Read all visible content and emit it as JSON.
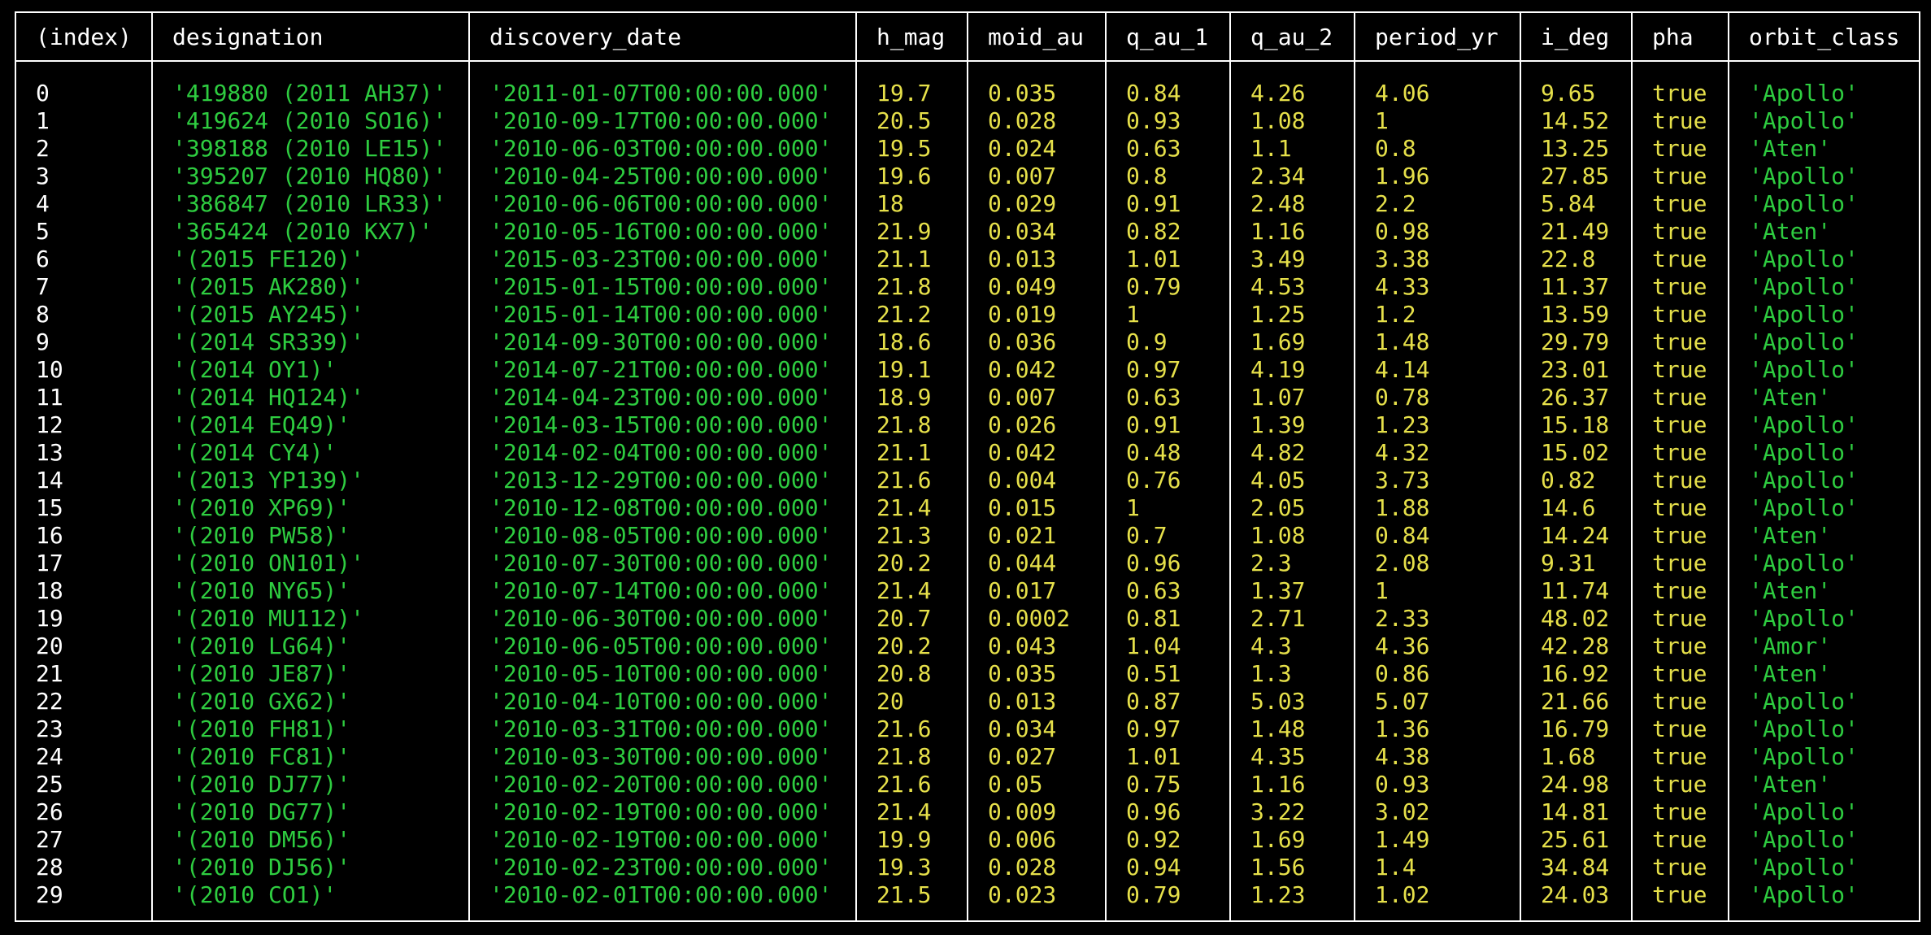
{
  "colors": {
    "background": "#000000",
    "border": "#ffffff",
    "index_text": "#ffffff",
    "string_text": "#2ecc40",
    "number_text": "#e6e04a"
  },
  "columns": [
    {
      "key": "index",
      "label": "(index)",
      "color": "white"
    },
    {
      "key": "designation",
      "label": "designation",
      "color": "green"
    },
    {
      "key": "discovery_date",
      "label": "discovery_date",
      "color": "green"
    },
    {
      "key": "h_mag",
      "label": "h_mag",
      "color": "yellow"
    },
    {
      "key": "moid_au",
      "label": "moid_au",
      "color": "yellow"
    },
    {
      "key": "q_au_1",
      "label": "q_au_1",
      "color": "yellow"
    },
    {
      "key": "q_au_2",
      "label": "q_au_2",
      "color": "yellow"
    },
    {
      "key": "period_yr",
      "label": "period_yr",
      "color": "yellow"
    },
    {
      "key": "i_deg",
      "label": "i_deg",
      "color": "yellow"
    },
    {
      "key": "pha",
      "label": "pha",
      "color": "yellow"
    },
    {
      "key": "orbit_class",
      "label": "orbit_class",
      "color": "green"
    }
  ],
  "rows": [
    [
      "0",
      "'419880 (2011 AH37)'",
      "'2011-01-07T00:00:00.000'",
      "19.7",
      "0.035",
      "0.84",
      "4.26",
      "4.06",
      "9.65",
      "true",
      "'Apollo'"
    ],
    [
      "1",
      "'419624 (2010 SO16)'",
      "'2010-09-17T00:00:00.000'",
      "20.5",
      "0.028",
      "0.93",
      "1.08",
      "1",
      "14.52",
      "true",
      "'Apollo'"
    ],
    [
      "2",
      "'398188 (2010 LE15)'",
      "'2010-06-03T00:00:00.000'",
      "19.5",
      "0.024",
      "0.63",
      "1.1",
      "0.8",
      "13.25",
      "true",
      "'Aten'"
    ],
    [
      "3",
      "'395207 (2010 HQ80)'",
      "'2010-04-25T00:00:00.000'",
      "19.6",
      "0.007",
      "0.8",
      "2.34",
      "1.96",
      "27.85",
      "true",
      "'Apollo'"
    ],
    [
      "4",
      "'386847 (2010 LR33)'",
      "'2010-06-06T00:00:00.000'",
      "18",
      "0.029",
      "0.91",
      "2.48",
      "2.2",
      "5.84",
      "true",
      "'Apollo'"
    ],
    [
      "5",
      "'365424 (2010 KX7)'",
      "'2010-05-16T00:00:00.000'",
      "21.9",
      "0.034",
      "0.82",
      "1.16",
      "0.98",
      "21.49",
      "true",
      "'Aten'"
    ],
    [
      "6",
      "'(2015 FE120)'",
      "'2015-03-23T00:00:00.000'",
      "21.1",
      "0.013",
      "1.01",
      "3.49",
      "3.38",
      "22.8",
      "true",
      "'Apollo'"
    ],
    [
      "7",
      "'(2015 AK280)'",
      "'2015-01-15T00:00:00.000'",
      "21.8",
      "0.049",
      "0.79",
      "4.53",
      "4.33",
      "11.37",
      "true",
      "'Apollo'"
    ],
    [
      "8",
      "'(2015 AY245)'",
      "'2015-01-14T00:00:00.000'",
      "21.2",
      "0.019",
      "1",
      "1.25",
      "1.2",
      "13.59",
      "true",
      "'Apollo'"
    ],
    [
      "9",
      "'(2014 SR339)'",
      "'2014-09-30T00:00:00.000'",
      "18.6",
      "0.036",
      "0.9",
      "1.69",
      "1.48",
      "29.79",
      "true",
      "'Apollo'"
    ],
    [
      "10",
      "'(2014 OY1)'",
      "'2014-07-21T00:00:00.000'",
      "19.1",
      "0.042",
      "0.97",
      "4.19",
      "4.14",
      "23.01",
      "true",
      "'Apollo'"
    ],
    [
      "11",
      "'(2014 HQ124)'",
      "'2014-04-23T00:00:00.000'",
      "18.9",
      "0.007",
      "0.63",
      "1.07",
      "0.78",
      "26.37",
      "true",
      "'Aten'"
    ],
    [
      "12",
      "'(2014 EQ49)'",
      "'2014-03-15T00:00:00.000'",
      "21.8",
      "0.026",
      "0.91",
      "1.39",
      "1.23",
      "15.18",
      "true",
      "'Apollo'"
    ],
    [
      "13",
      "'(2014 CY4)'",
      "'2014-02-04T00:00:00.000'",
      "21.1",
      "0.042",
      "0.48",
      "4.82",
      "4.32",
      "15.02",
      "true",
      "'Apollo'"
    ],
    [
      "14",
      "'(2013 YP139)'",
      "'2013-12-29T00:00:00.000'",
      "21.6",
      "0.004",
      "0.76",
      "4.05",
      "3.73",
      "0.82",
      "true",
      "'Apollo'"
    ],
    [
      "15",
      "'(2010 XP69)'",
      "'2010-12-08T00:00:00.000'",
      "21.4",
      "0.015",
      "1",
      "2.05",
      "1.88",
      "14.6",
      "true",
      "'Apollo'"
    ],
    [
      "16",
      "'(2010 PW58)'",
      "'2010-08-05T00:00:00.000'",
      "21.3",
      "0.021",
      "0.7",
      "1.08",
      "0.84",
      "14.24",
      "true",
      "'Aten'"
    ],
    [
      "17",
      "'(2010 ON101)'",
      "'2010-07-30T00:00:00.000'",
      "20.2",
      "0.044",
      "0.96",
      "2.3",
      "2.08",
      "9.31",
      "true",
      "'Apollo'"
    ],
    [
      "18",
      "'(2010 NY65)'",
      "'2010-07-14T00:00:00.000'",
      "21.4",
      "0.017",
      "0.63",
      "1.37",
      "1",
      "11.74",
      "true",
      "'Aten'"
    ],
    [
      "19",
      "'(2010 MU112)'",
      "'2010-06-30T00:00:00.000'",
      "20.7",
      "0.0002",
      "0.81",
      "2.71",
      "2.33",
      "48.02",
      "true",
      "'Apollo'"
    ],
    [
      "20",
      "'(2010 LG64)'",
      "'2010-06-05T00:00:00.000'",
      "20.2",
      "0.043",
      "1.04",
      "4.3",
      "4.36",
      "42.28",
      "true",
      "'Amor'"
    ],
    [
      "21",
      "'(2010 JE87)'",
      "'2010-05-10T00:00:00.000'",
      "20.8",
      "0.035",
      "0.51",
      "1.3",
      "0.86",
      "16.92",
      "true",
      "'Aten'"
    ],
    [
      "22",
      "'(2010 GX62)'",
      "'2010-04-10T00:00:00.000'",
      "20",
      "0.013",
      "0.87",
      "5.03",
      "5.07",
      "21.66",
      "true",
      "'Apollo'"
    ],
    [
      "23",
      "'(2010 FH81)'",
      "'2010-03-31T00:00:00.000'",
      "21.6",
      "0.034",
      "0.97",
      "1.48",
      "1.36",
      "16.79",
      "true",
      "'Apollo'"
    ],
    [
      "24",
      "'(2010 FC81)'",
      "'2010-03-30T00:00:00.000'",
      "21.8",
      "0.027",
      "1.01",
      "4.35",
      "4.38",
      "1.68",
      "true",
      "'Apollo'"
    ],
    [
      "25",
      "'(2010 DJ77)'",
      "'2010-02-20T00:00:00.000'",
      "21.6",
      "0.05",
      "0.75",
      "1.16",
      "0.93",
      "24.98",
      "true",
      "'Aten'"
    ],
    [
      "26",
      "'(2010 DG77)'",
      "'2010-02-19T00:00:00.000'",
      "21.4",
      "0.009",
      "0.96",
      "3.22",
      "3.02",
      "14.81",
      "true",
      "'Apollo'"
    ],
    [
      "27",
      "'(2010 DM56)'",
      "'2010-02-19T00:00:00.000'",
      "19.9",
      "0.006",
      "0.92",
      "1.69",
      "1.49",
      "25.61",
      "true",
      "'Apollo'"
    ],
    [
      "28",
      "'(2010 DJ56)'",
      "'2010-02-23T00:00:00.000'",
      "19.3",
      "0.028",
      "0.94",
      "1.56",
      "1.4",
      "34.84",
      "true",
      "'Apollo'"
    ],
    [
      "29",
      "'(2010 CO1)'",
      "'2010-02-01T00:00:00.000'",
      "21.5",
      "0.023",
      "0.79",
      "1.23",
      "1.02",
      "24.03",
      "true",
      "'Apollo'"
    ]
  ]
}
